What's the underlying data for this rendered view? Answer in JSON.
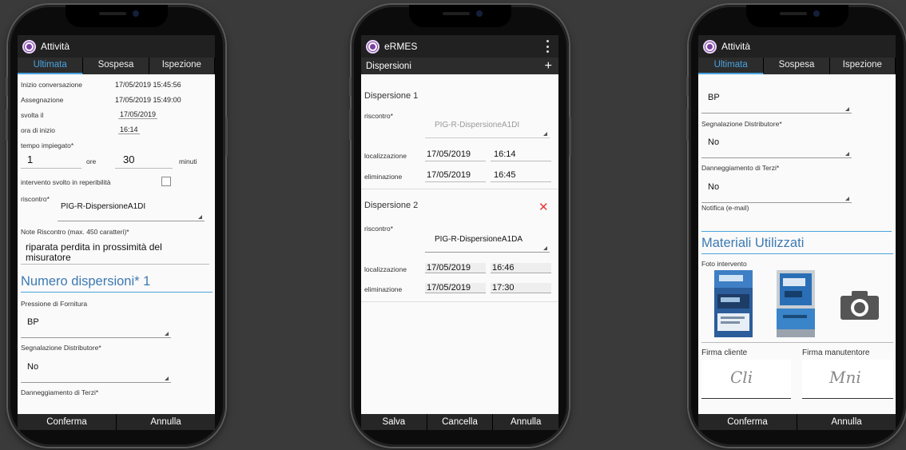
{
  "phone1": {
    "title": "Attività",
    "tabs": [
      "Ultimata",
      "Sospesa",
      "Ispezione"
    ],
    "inizio_label": "Inizio conversazione",
    "inizio_value": "17/05/2019 15:45:56",
    "assegnazione_label": "Assegnazione",
    "assegnazione_value": "17/05/2019 15:49:00",
    "svolta_label": "svolta il",
    "svolta_value": "17/05/2019",
    "ora_label": "ora di inizio",
    "ora_value": "16:14",
    "tempo_label": "tempo impiegato*",
    "ore_value": "1",
    "ore_label": "ore",
    "minuti_value": "30",
    "minuti_label": "minuti",
    "reperibilita_label": "intervento svolto in reperibilità",
    "riscontro_label": "riscontro*",
    "riscontro_value": "PIG-R-DispersioneA1DI",
    "note_label": "Note Riscontro  (max. 450 caratteri)*",
    "note_value_1": "riparata perdita in prossimità del",
    "note_value_2": "misuratore",
    "dispersioni_heading": "Numero dispersioni* 1",
    "pressione_label": "Pressione di Fornitura",
    "pressione_value": "BP",
    "segnalazione_label": "Segnalazione Distributore*",
    "segnalazione_value": "No",
    "danneggiamento_label": "Danneggiamento di Terzi*",
    "buttons": [
      "Conferma",
      "Annulla"
    ]
  },
  "phone2": {
    "title": "eRMES",
    "subtitle": "Dispersioni",
    "plus": "+",
    "d1_title": "Dispersione 1",
    "d1_riscontro_label": "riscontro*",
    "d1_riscontro_value": "PIG-R-DispersioneA1DI",
    "d1_loc_label": "localizzazione",
    "d1_loc_date": "17/05/2019",
    "d1_loc_time": "16:14",
    "d1_elim_label": "eliminazione",
    "d1_elim_date": "17/05/2019",
    "d1_elim_time": "16:45",
    "d2_title": "Dispersione 2",
    "d2_close": "✕",
    "d2_riscontro_label": "riscontro*",
    "d2_riscontro_value": "PIG-R-DispersioneA1DA",
    "d2_loc_label": "localizzazione",
    "d2_loc_date": "17/05/2019",
    "d2_loc_time": "16:46",
    "d2_elim_label": "eliminazione",
    "d2_elim_date": "17/05/2019",
    "d2_elim_time": "17:30",
    "buttons": [
      "Salva",
      "Cancella",
      "Annulla"
    ]
  },
  "phone3": {
    "title": "Attività",
    "tabs": [
      "Ultimata",
      "Sospesa",
      "Ispezione"
    ],
    "pressione_value": "BP",
    "segnalazione_label": "Segnalazione Distributore*",
    "segnalazione_value": "No",
    "danneggiamento_label": "Danneggiamento di Terzi*",
    "danneggiamento_value": "No",
    "notifica_label": "Notifica (e-mail)",
    "materiali_heading": "Materiali Utilizzati",
    "foto_label": "Foto intervento",
    "firma_cliente_label": "Firma cliente",
    "firma_manutentore_label": "Firma manutentore",
    "firma_cliente_sig": "Cli",
    "firma_manutentore_sig": "Mni",
    "buttons": [
      "Conferma",
      "Annulla"
    ]
  },
  "colors": {
    "accent": "#4aa3df",
    "heading": "#3d7ab3",
    "appbar": "#212121",
    "close": "#e53935"
  }
}
